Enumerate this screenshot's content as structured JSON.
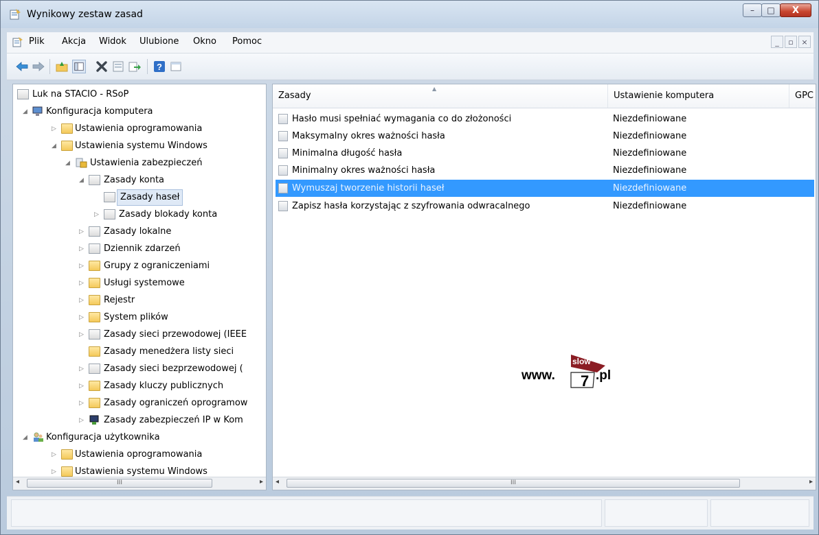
{
  "window": {
    "title": "Wynikowy zestaw zasad",
    "controls": {
      "minimize": "–",
      "maximize": "□",
      "close": "X"
    }
  },
  "menu": {
    "items": [
      "Plik",
      "Akcja",
      "Widok",
      "Ulubione",
      "Okno",
      "Pomoc"
    ],
    "mdi_controls": [
      "_",
      "▫",
      "×"
    ]
  },
  "toolbar": {
    "icons": [
      "back-icon",
      "forward-icon",
      "up-folder-icon",
      "show-hide-tree-icon",
      "delete-icon",
      "properties-icon",
      "export-icon",
      "help-icon",
      "view-icon"
    ]
  },
  "tree": {
    "root": "Luk na STACIO - RSoP",
    "computer_config": "Konfiguracja komputera",
    "software_settings": "Ustawienia oprogramowania",
    "windows_settings": "Ustawienia systemu Windows",
    "security_settings": "Ustawienia zabezpieczeń",
    "account_policies": "Zasady konta",
    "password_policy": "Zasady haseł",
    "lockout_policy": "Zasady blokady konta",
    "local_policies": "Zasady lokalne",
    "event_log": "Dziennik zdarzeń",
    "restricted_groups": "Grupy z ograniczeniami",
    "system_services": "Usługi systemowe",
    "registry": "Rejestr",
    "file_system": "System plików",
    "wired_network": "Zasady sieci przewodowej (IEEE",
    "network_list": "Zasady menedżera listy sieci",
    "wireless_network": "Zasady sieci bezprzewodowej (",
    "public_key": "Zasady kluczy publicznych",
    "software_restriction": "Zasady ograniczeń oprogramow",
    "ip_security": "Zasady zabezpieczeń IP w Kom",
    "user_config": "Konfiguracja użytkownika",
    "user_software_settings": "Ustawienia oprogramowania",
    "user_windows_settings": "Ustawienia systemu Windows"
  },
  "list": {
    "columns": [
      "Zasady",
      "Ustawienie komputera",
      "GPC"
    ],
    "rows": [
      {
        "name": "Hasło musi spełniać wymagania co do złożoności",
        "value": "Niezdefiniowane"
      },
      {
        "name": "Maksymalny okres ważności hasła",
        "value": "Niezdefiniowane"
      },
      {
        "name": "Minimalna długość hasła",
        "value": "Niezdefiniowane"
      },
      {
        "name": "Minimalny okres ważności hasła",
        "value": "Niezdefiniowane"
      },
      {
        "name": "Wymuszaj tworzenie historii haseł",
        "value": "Niezdefiniowane"
      },
      {
        "name": "Zapisz hasła korzystając z szyfrowania odwracalnego",
        "value": "Niezdefiniowane"
      }
    ],
    "selected_row": 4
  },
  "scroll": {
    "left_arrow": "◂",
    "right_arrow": "▸",
    "grip": "III"
  },
  "watermark": {
    "prefix": "www.",
    "badge_top": "slow",
    "badge_num": "7",
    "suffix": ".pl"
  },
  "colors": {
    "selection": "#3399ff",
    "titlebar": "#c9d8ea",
    "close": "#c8452e"
  }
}
